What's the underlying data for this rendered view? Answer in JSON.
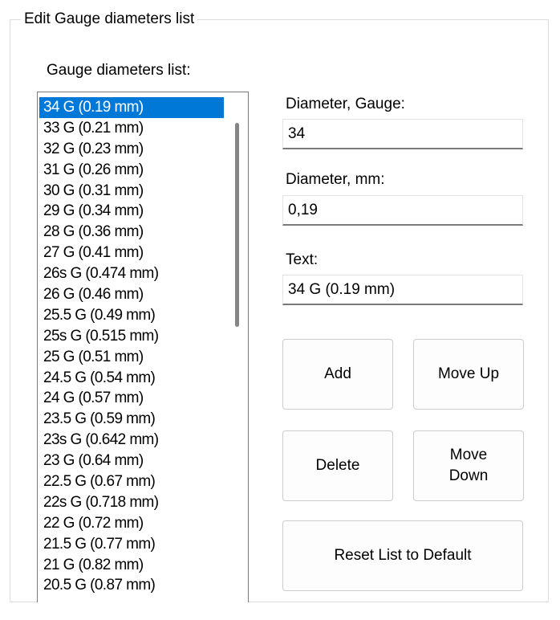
{
  "group": {
    "title": "Edit Gauge diameters list"
  },
  "list": {
    "label": "Gauge diameters list:",
    "selected_index": 0,
    "items": [
      "34 G (0.19 mm)",
      "33 G (0.21 mm)",
      "32 G (0.23 mm)",
      "31 G (0.26 mm)",
      "30 G (0.31 mm)",
      "29 G (0.34 mm)",
      "28 G (0.36 mm)",
      "27 G (0.41 mm)",
      "26s G (0.474 mm)",
      "26 G (0.46 mm)",
      "25.5 G (0.49 mm)",
      "25s G (0.515 mm)",
      "25 G (0.51 mm)",
      "24.5 G (0.54 mm)",
      "24 G (0.57 mm)",
      "23.5 G (0.59 mm)",
      "23s G (0.642 mm)",
      "23 G (0.64 mm)",
      "22.5 G (0.67 mm)",
      "22s G (0.718 mm)",
      "22 G (0.72 mm)",
      "21.5 G (0.77 mm)",
      "21 G (0.82 mm)",
      "20.5 G (0.87 mm)"
    ]
  },
  "fields": {
    "gauge": {
      "label": "Diameter, Gauge:",
      "value": "34"
    },
    "mm": {
      "label": "Diameter, mm:",
      "value": "0,19"
    },
    "text": {
      "label": "Text:",
      "value": "34 G (0.19 mm)"
    }
  },
  "buttons": {
    "add": "Add",
    "move_up": "Move Up",
    "delete": "Delete",
    "move_down": "Move Down",
    "reset": "Reset List to Default"
  },
  "colors": {
    "selection": "#0078d7",
    "selection_text": "#ffffff"
  }
}
